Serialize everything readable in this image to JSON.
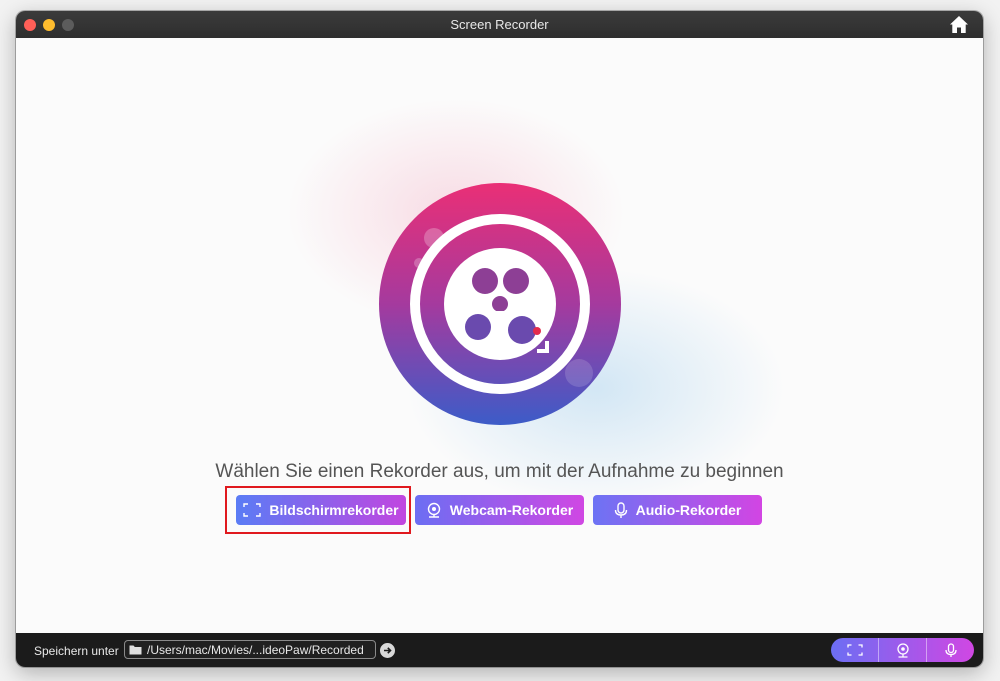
{
  "window": {
    "title": "Screen Recorder",
    "icons": {
      "home": "home-icon"
    }
  },
  "main": {
    "prompt": "Wählen Sie einen Rekorder aus, um mit der Aufnahme zu beginnen",
    "buttons": [
      {
        "label": "Bildschirmrekorder",
        "icon": "screen-capture-icon"
      },
      {
        "label": "Webcam-Rekorder",
        "icon": "webcam-icon"
      },
      {
        "label": "Audio-Rekorder",
        "icon": "microphone-icon"
      }
    ]
  },
  "footer": {
    "save_label": "Speichern unter",
    "path": "/Users/mac/Movies/...ideoPaw/Recorded",
    "icons": {
      "folder": "folder-icon",
      "open": "arrow-right-icon"
    }
  },
  "colors": {
    "titlebar": "#2e2e2e",
    "button_start": "#5a7cf5",
    "button_end": "#d047e3",
    "highlight": "#e0191e",
    "logo_top": "#e8397a",
    "logo_bottom": "#3f59c8",
    "record_dot": "#e32b4c"
  }
}
